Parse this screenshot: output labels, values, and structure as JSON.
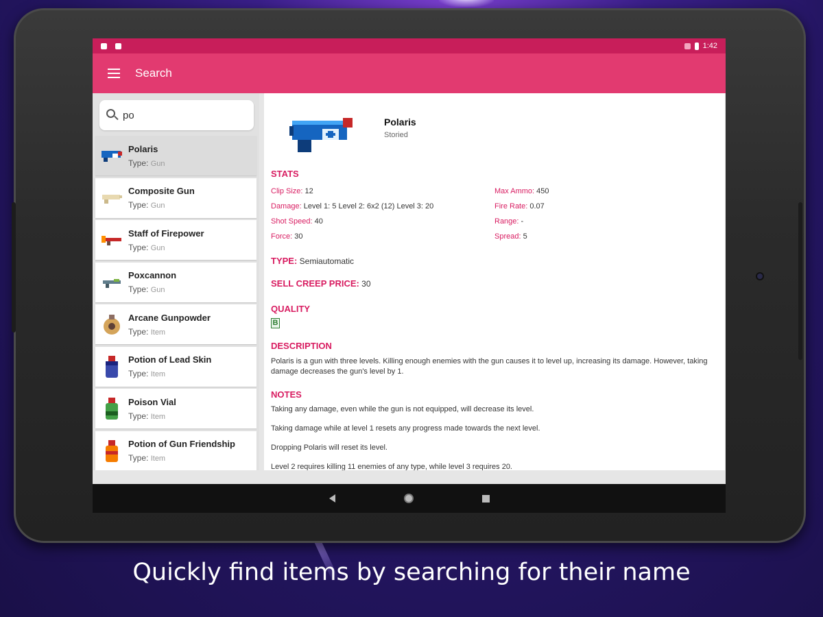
{
  "status_bar": {
    "time": "1:42"
  },
  "app_bar": {
    "title": "Search",
    "menu_icon": "hamburger-menu-icon"
  },
  "search": {
    "value": "po"
  },
  "list": {
    "type_label": "Type:",
    "items": [
      {
        "name": "Polaris",
        "type": "Gun",
        "selected": true,
        "icon": "blue-gun-icon"
      },
      {
        "name": "Composite Gun",
        "type": "Gun",
        "icon": "beige-gun-icon"
      },
      {
        "name": "Staff of Firepower",
        "type": "Gun",
        "icon": "red-staff-icon"
      },
      {
        "name": "Poxcannon",
        "type": "Gun",
        "icon": "green-gun-icon"
      },
      {
        "name": "Arcane Gunpowder",
        "type": "Item",
        "icon": "powder-bag-icon"
      },
      {
        "name": "Potion of Lead Skin",
        "type": "Item",
        "icon": "blue-potion-icon"
      },
      {
        "name": "Poison Vial",
        "type": "Item",
        "icon": "green-potion-icon"
      },
      {
        "name": "Potion of Gun Friendship",
        "type": "Item",
        "icon": "orange-potion-icon"
      }
    ]
  },
  "detail": {
    "name": "Polaris",
    "subtitle": "Storied",
    "stats_heading": "STATS",
    "stats": {
      "clip_size": {
        "label": "Clip Size:",
        "value": "12"
      },
      "max_ammo": {
        "label": "Max Ammo:",
        "value": "450"
      },
      "damage": {
        "label": "Damage:",
        "value": "Level 1: 5 Level 2: 6x2 (12) Level 3: 20"
      },
      "fire_rate": {
        "label": "Fire Rate:",
        "value": "0.07"
      },
      "shot_speed": {
        "label": "Shot Speed:",
        "value": "40"
      },
      "range": {
        "label": "Range:",
        "value": "-"
      },
      "force": {
        "label": "Force:",
        "value": "30"
      },
      "spread": {
        "label": "Spread:",
        "value": "5"
      }
    },
    "type": {
      "label": "TYPE:",
      "value": "Semiautomatic"
    },
    "sell_price": {
      "label": "SELL CREEP PRICE:",
      "value": "30"
    },
    "quality": {
      "heading": "QUALITY",
      "grade": "B"
    },
    "description": {
      "heading": "DESCRIPTION",
      "text": "Polaris is a gun with three levels. Killing enough enemies with the gun causes it to level up, increasing its damage. However, taking damage decreases the gun's level by 1."
    },
    "notes": {
      "heading": "NOTES",
      "items": [
        "Taking any damage, even while the gun is not equipped, will decrease its level.",
        "Taking damage while at level 1 resets any progress made towards the next level.",
        "Dropping Polaris will reset its level.",
        "Level 2 requires killing 11 enemies of any type, while level 3 requires 20."
      ]
    }
  },
  "caption": "Quickly find items by searching for their name"
}
